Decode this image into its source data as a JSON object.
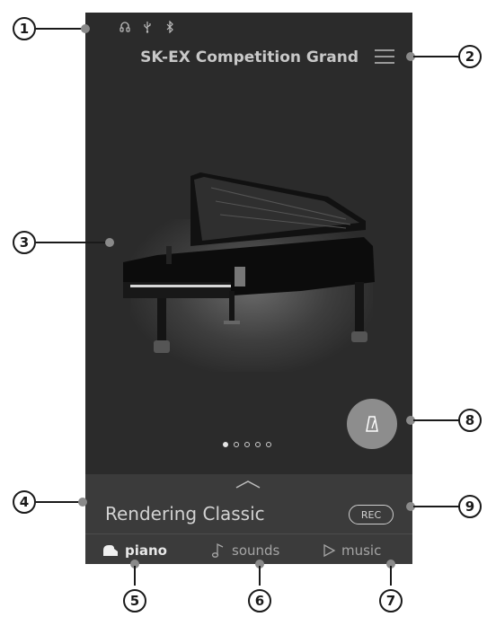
{
  "status_icons": [
    "headphones-icon",
    "usb-icon",
    "bluetooth-icon"
  ],
  "header": {
    "title": "SK-EX Competition Grand",
    "menu_icon": "hamburger-menu-icon"
  },
  "carousel": {
    "image": "grand-piano",
    "pages": 5,
    "active_page": 1
  },
  "metronome": {
    "icon": "metronome-icon"
  },
  "panel": {
    "expand_icon": "chevron-up-icon",
    "sound_name": "Rendering Classic",
    "rec_label": "REC"
  },
  "tabs": [
    {
      "label": "piano",
      "icon": "piano-icon",
      "active": true
    },
    {
      "label": "sounds",
      "icon": "music-note-icon",
      "active": false
    },
    {
      "label": "music",
      "icon": "play-icon",
      "active": false
    }
  ],
  "callouts": [
    "1",
    "2",
    "3",
    "4",
    "5",
    "6",
    "7",
    "8",
    "9"
  ],
  "colors": {
    "screen_bg": "#2b2b2b",
    "panel_bg": "#3b3b3b",
    "accent_button": "#8d8d8d"
  }
}
